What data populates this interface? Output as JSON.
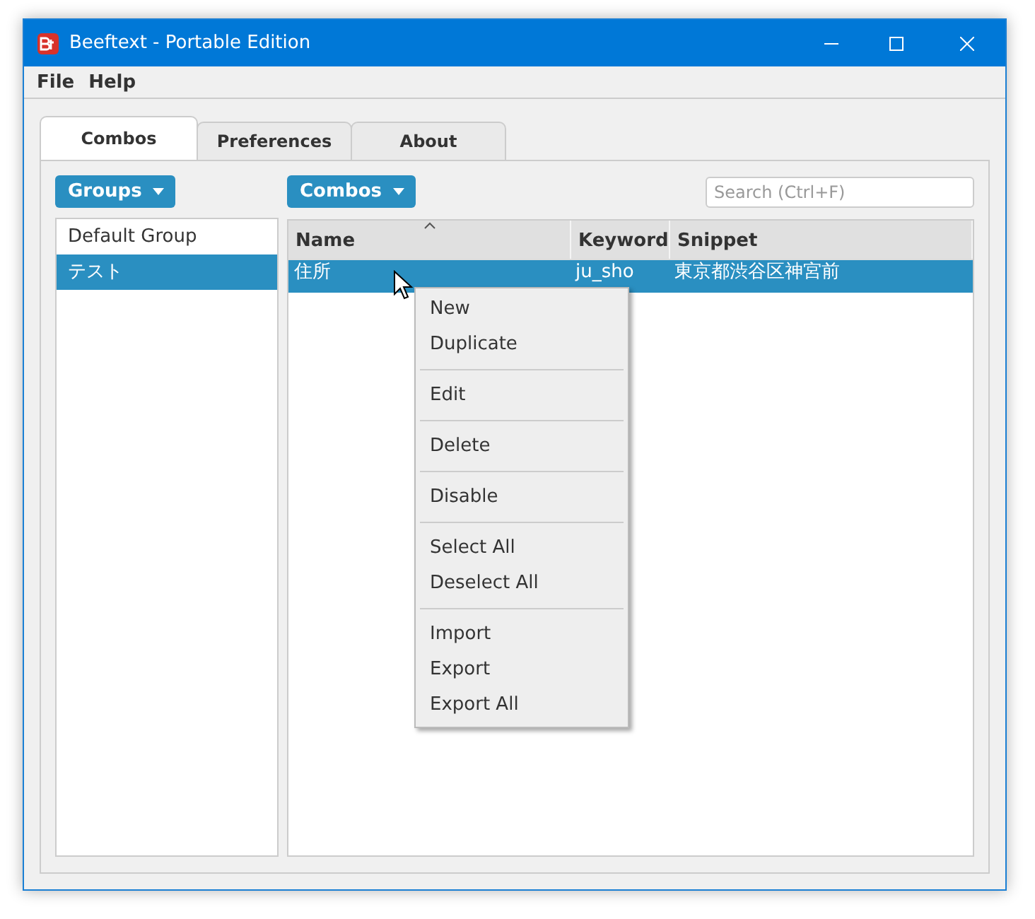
{
  "window": {
    "title": "Beeftext - Portable Edition"
  },
  "menu_bar": [
    "File",
    "Help"
  ],
  "tabs": [
    {
      "label": "Combos",
      "selected": true
    },
    {
      "label": "Preferences",
      "selected": false
    },
    {
      "label": "About",
      "selected": false
    }
  ],
  "groups_button": "Groups",
  "groups": [
    {
      "label": "Default Group",
      "selected": false
    },
    {
      "label": "テスト",
      "selected": true
    }
  ],
  "combos_button": "Combos",
  "search": {
    "placeholder": "Search (Ctrl+F)"
  },
  "table": {
    "columns": [
      "Name",
      "Keyword",
      "Snippet"
    ],
    "rows": [
      {
        "cells": [
          "住所",
          "ju_sho",
          "東京都渋谷区神宮前"
        ],
        "selected": true
      }
    ]
  },
  "context_menu": [
    {
      "kind": "item",
      "label": "New"
    },
    {
      "kind": "item",
      "label": "Duplicate"
    },
    {
      "kind": "separator"
    },
    {
      "kind": "item",
      "label": "Edit"
    },
    {
      "kind": "separator"
    },
    {
      "kind": "item",
      "label": "Delete"
    },
    {
      "kind": "separator"
    },
    {
      "kind": "item",
      "label": "Disable"
    },
    {
      "kind": "separator"
    },
    {
      "kind": "item",
      "label": "Select All"
    },
    {
      "kind": "item",
      "label": "Deselect All"
    },
    {
      "kind": "separator"
    },
    {
      "kind": "item",
      "label": "Import"
    },
    {
      "kind": "item",
      "label": "Export"
    },
    {
      "kind": "item",
      "label": "Export All"
    }
  ]
}
